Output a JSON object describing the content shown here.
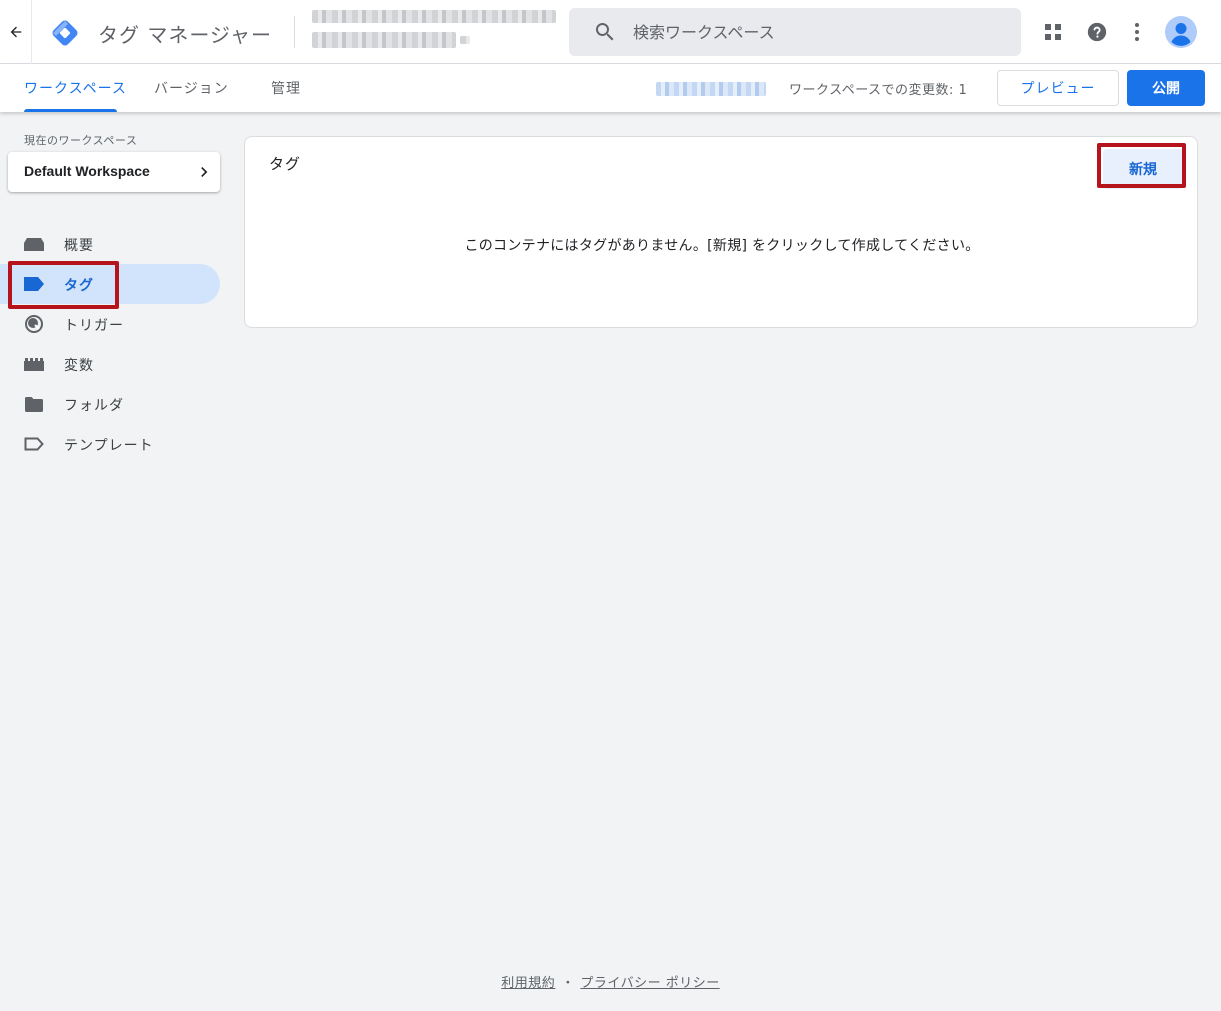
{
  "header": {
    "app_title": "タグ マネージャー",
    "search_placeholder": "検索ワークスペース",
    "icons": [
      "arrow-back-icon",
      "gtm-logo-icon",
      "search-icon",
      "apps-grid-icon",
      "help-icon",
      "more-vert-icon",
      "account-avatar-icon"
    ]
  },
  "tabs": [
    {
      "label": "ワークスペース",
      "active": true
    },
    {
      "label": "バージョン",
      "active": false
    },
    {
      "label": "管理",
      "active": false
    }
  ],
  "status": {
    "changes_text": "ワークスペースでの変更数: 1"
  },
  "actions": {
    "preview_label": "プレビュー",
    "publish_label": "公開"
  },
  "sidebar": {
    "current_ws_label": "現在のワークスペース",
    "workspace_name": "Default Workspace",
    "items": [
      {
        "label": "概要",
        "icon": "overview-icon",
        "active": false
      },
      {
        "label": "タグ",
        "icon": "tag-icon",
        "active": true
      },
      {
        "label": "トリガー",
        "icon": "trigger-icon",
        "active": false
      },
      {
        "label": "変数",
        "icon": "variables-icon",
        "active": false
      },
      {
        "label": "フォルダ",
        "icon": "folder-icon",
        "active": false
      },
      {
        "label": "テンプレート",
        "icon": "template-icon",
        "active": false
      }
    ]
  },
  "main": {
    "card_title": "タグ",
    "new_label": "新規",
    "empty_message": "このコンテナにはタグがありません。[新規] をクリックして作成してください。"
  },
  "footer": {
    "terms": "利用規約",
    "separator": "・",
    "privacy": "プライバシー ポリシー"
  },
  "colors": {
    "accent": "#1a73e8",
    "active_nav_bg": "#d2e3fc",
    "highlight": "#b5141c",
    "background": "#f1f3f4"
  }
}
